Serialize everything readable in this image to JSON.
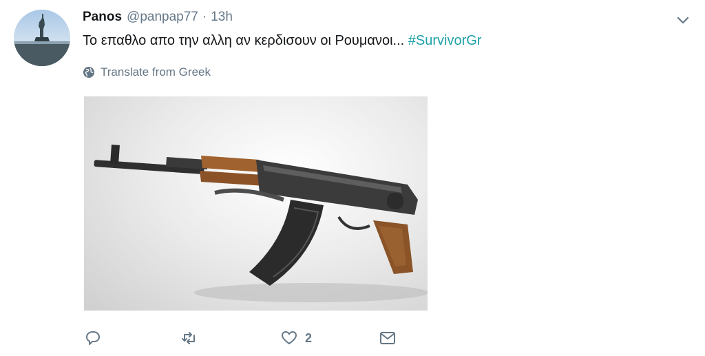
{
  "tweet": {
    "author_name": "Panos",
    "author_handle": "@panpap77",
    "separator": "·",
    "time": "13h",
    "text": "Το επαθλο απο την αλλη αν κερδισουν οι Ρουμανοι... ",
    "hashtag": "#SurvivorGr",
    "translate_label": "Translate from Greek",
    "like_count": "2"
  },
  "icons": {
    "menu": "chevron-down-icon",
    "globe": "globe-icon",
    "reply": "reply-icon",
    "retweet": "retweet-icon",
    "like": "heart-icon",
    "message": "envelope-icon"
  },
  "colors": {
    "hashtag": "#1da1a8",
    "muted": "#657786",
    "text": "#14171a"
  }
}
